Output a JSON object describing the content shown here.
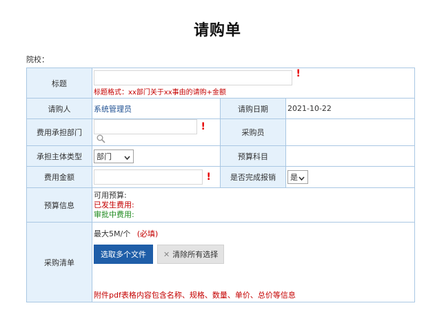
{
  "page": {
    "title": "请购单",
    "school_label": "院校："
  },
  "form": {
    "subject": {
      "label": "标题",
      "value": "",
      "required_mark": "!",
      "hint": "标题格式：xx部门关于xx事由的请购+金额"
    },
    "requester": {
      "label": "请购人",
      "value": "系统管理员"
    },
    "request_date": {
      "label": "请购日期",
      "value": "2021-10-22"
    },
    "cost_department": {
      "label": "费用承担部门",
      "value": "",
      "required_mark": "!"
    },
    "purchaser": {
      "label": "采购员",
      "value": ""
    },
    "bearer_type": {
      "label": "承担主体类型",
      "selected": "部门"
    },
    "budget_subject": {
      "label": "预算科目",
      "value": ""
    },
    "amount": {
      "label": "费用金额",
      "value": "",
      "required_mark": "!"
    },
    "reimbursed": {
      "label": "是否完成报销",
      "selected": "是"
    },
    "budget_info": {
      "label": "预算信息",
      "available": "可用预算:",
      "incurred": "已发生费用:",
      "in_approval": "审批中费用:"
    },
    "purchase_list": {
      "label": "采购清单",
      "limit_text": "最大5M/个",
      "required_text": "(必填)",
      "select_files_label": "选取多个文件",
      "clear_label": "清除所有选择",
      "attachment_note": "附件pdf表格内容包含名称、规格、数量、单价、总价等信息"
    }
  },
  "colors": {
    "header_bg": "#e5f1fb",
    "border": "#a9c7e3",
    "primary_button": "#1f5ea8",
    "required": "#e60000",
    "hint_red": "#c40000",
    "green": "#1f8a1f"
  }
}
